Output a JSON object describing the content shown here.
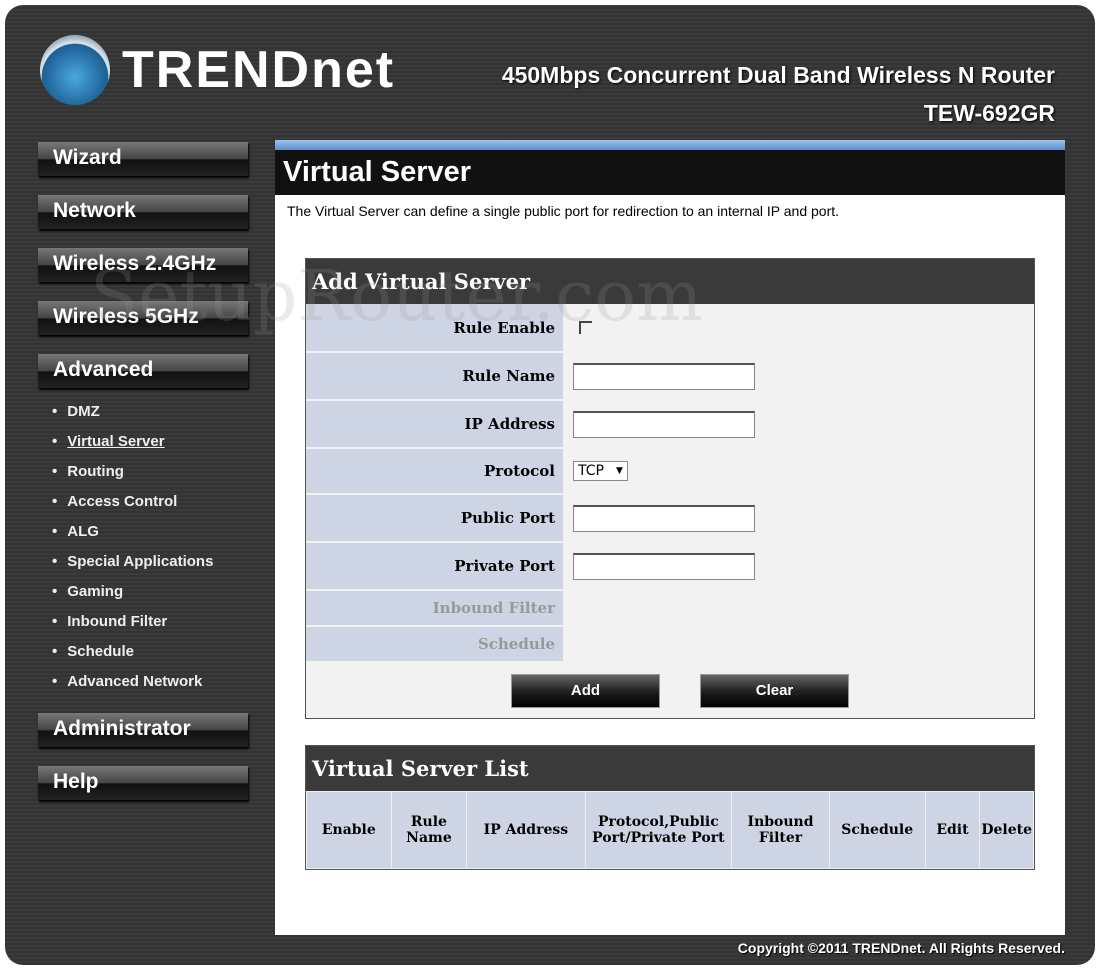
{
  "header": {
    "brand": "TRENDnet",
    "product": "450Mbps Concurrent Dual Band Wireless N Router",
    "model": "TEW-692GR"
  },
  "sidebar": {
    "items": [
      "Wizard",
      "Network",
      "Wireless 2.4GHz",
      "Wireless 5GHz",
      "Advanced"
    ],
    "advanced_sub": [
      "DMZ",
      "Virtual Server",
      "Routing",
      "Access Control",
      "ALG",
      "Special Applications",
      "Gaming",
      "Inbound Filter",
      "Schedule",
      "Advanced Network"
    ],
    "active": "Virtual Server",
    "bottom": [
      "Administrator",
      "Help"
    ]
  },
  "page": {
    "title": "Virtual Server",
    "description": "The Virtual Server can define a single public port for redirection to an internal IP and port."
  },
  "form": {
    "title": "Add Virtual Server",
    "rule_enable": "Rule Enable",
    "rule_enabled": false,
    "rule_name": "Rule Name",
    "rule_name_value": "",
    "ip_address": "IP Address",
    "ip_address_value": "",
    "protocol": "Protocol",
    "protocol_value": "TCP",
    "public_port": "Public Port",
    "public_port_value": "",
    "private_port": "Private Port",
    "private_port_value": "",
    "inbound_filter": "Inbound Filter",
    "schedule": "Schedule",
    "add": "Add",
    "clear": "Clear"
  },
  "list": {
    "title": "Virtual Server List",
    "columns": [
      "Enable",
      "Rule Name",
      "IP Address",
      "Protocol,Public Port/Private Port",
      "Inbound Filter",
      "Schedule",
      "Edit",
      "Delete"
    ]
  },
  "footer": "Copyright ©2011 TRENDnet. All Rights Reserved.",
  "watermark": "SetupRouter.com"
}
